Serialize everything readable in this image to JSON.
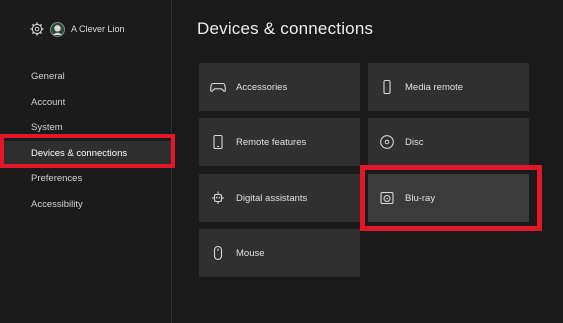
{
  "profile": {
    "gamertag": "A Clever Lion"
  },
  "sidebar": {
    "items": [
      {
        "label": "General"
      },
      {
        "label": "Account"
      },
      {
        "label": "System"
      },
      {
        "label": "Devices & connections",
        "selected": true
      },
      {
        "label": "Preferences"
      },
      {
        "label": "Accessibility"
      }
    ]
  },
  "main": {
    "title": "Devices & connections",
    "tiles": [
      {
        "label": "Accessories",
        "icon": "gamepad-icon"
      },
      {
        "label": "Media remote",
        "icon": "remote-icon"
      },
      {
        "label": "Remote features",
        "icon": "phone-icon"
      },
      {
        "label": "Disc",
        "icon": "disc-icon"
      },
      {
        "label": "Digital assistants",
        "icon": "assistant-icon"
      },
      {
        "label": "Blu-ray",
        "icon": "bluray-icon",
        "focused": true
      },
      {
        "label": "Mouse",
        "icon": "mouse-icon"
      }
    ]
  },
  "colors": {
    "background": "#1a1a1a",
    "tile": "#303030",
    "highlight": "#e3172a"
  }
}
